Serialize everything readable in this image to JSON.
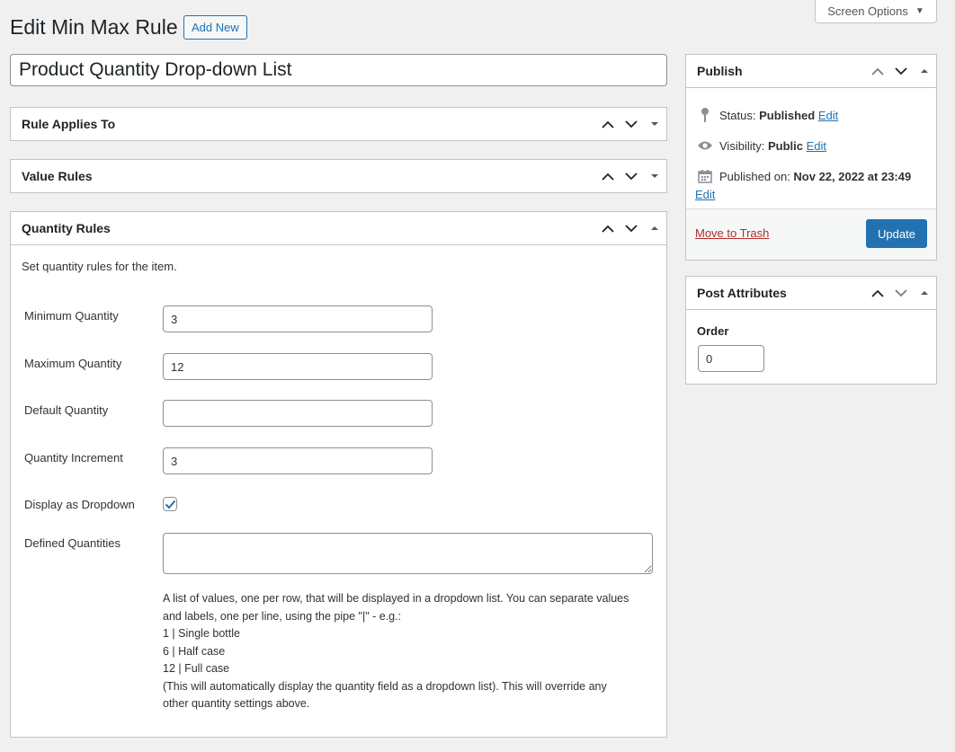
{
  "screen_options": {
    "label": "Screen Options",
    "caret": "▼"
  },
  "header": {
    "title": "Edit Min Max Rule",
    "add_new": "Add New"
  },
  "post_title": "Product Quantity Drop-down List",
  "boxes": {
    "applies_to": {
      "title": "Rule Applies To"
    },
    "value_rules": {
      "title": "Value Rules"
    },
    "quantity_rules": {
      "title": "Quantity Rules",
      "description": "Set quantity rules for the item.",
      "fields": {
        "min": {
          "label": "Minimum Quantity",
          "value": "3"
        },
        "max": {
          "label": "Maximum Quantity",
          "value": "12"
        },
        "default": {
          "label": "Default Quantity",
          "value": ""
        },
        "increment": {
          "label": "Quantity Increment",
          "value": "3"
        },
        "dropdown": {
          "label": "Display as Dropdown",
          "checked": true
        },
        "defined": {
          "label": "Defined Quantities",
          "value": ""
        }
      },
      "help_lines": [
        "A list of values, one per row, that will be displayed in a dropdown list. You can separate values",
        "and labels, one per line, using the pipe \"|\" - e.g.:",
        "1 | Single bottle",
        "6 | Half case",
        "12 | Full case",
        "(This will automatically display the quantity field as a dropdown list). This will override any",
        "other quantity settings above."
      ]
    }
  },
  "publish": {
    "title": "Publish",
    "status_label": "Status:",
    "status_value": "Published",
    "visibility_label": "Visibility:",
    "visibility_value": "Public",
    "published_label": "Published on:",
    "published_value": "Nov 22, 2022 at 23:49",
    "edit": "Edit",
    "trash": "Move to Trash",
    "update": "Update"
  },
  "attributes": {
    "title": "Post Attributes",
    "order_label": "Order",
    "order_value": "0"
  },
  "colors": {
    "accent": "#2271b1",
    "danger": "#b32d2e",
    "background": "#f0f0f1"
  }
}
